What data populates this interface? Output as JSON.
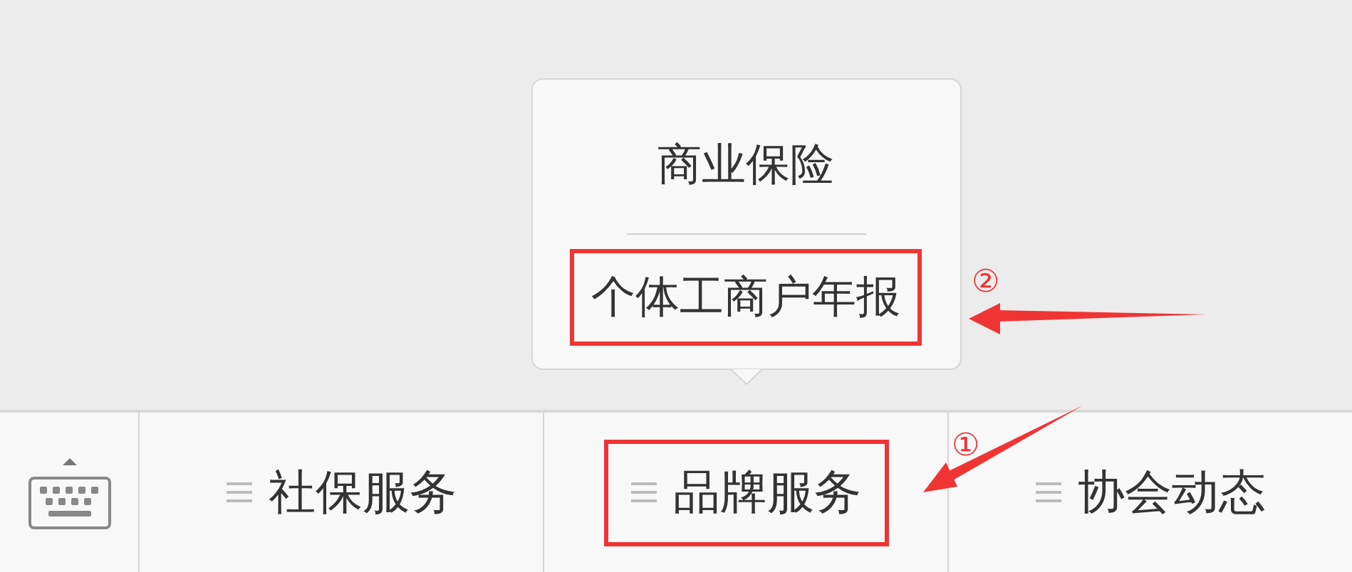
{
  "menu": {
    "items": [
      {
        "label": "社保服务",
        "annotated": false
      },
      {
        "label": "品牌服务",
        "annotated": true,
        "expanded": true,
        "submenu": [
          {
            "label": "商业保险",
            "annotated": false
          },
          {
            "label": "个体工商户年报",
            "annotated": true
          }
        ]
      },
      {
        "label": "协会动态",
        "annotated": false
      }
    ]
  },
  "annotations": [
    {
      "label": "②"
    },
    {
      "label": "①"
    }
  ]
}
